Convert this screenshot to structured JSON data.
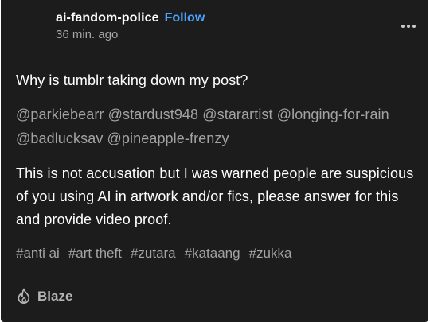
{
  "post": {
    "blog_name": "ai-fandom-police",
    "follow_label": "Follow",
    "timestamp": "36 min. ago",
    "title": "Why is tumblr taking down my post?",
    "mentions": "@parkiebearr @stardust948 @starartist @longing-for-rain @badlucksav @pineapple-frenzy",
    "body": "This is not accusation but I was warned people are suspicious of you using AI in artwork and/or fics, please answer for this and provide video proof.",
    "tags": [
      "#anti ai",
      "#art theft",
      "#zutara",
      "#kataang",
      "#zukka"
    ]
  },
  "footer": {
    "blaze_label": "Blaze",
    "blaze_icon": "flame-icon"
  },
  "header": {
    "more_icon": "more-options-icon"
  },
  "colors": {
    "background": "#1c1c1c",
    "follow": "#4aa3ff",
    "muted_text": "#a3a3a3"
  }
}
